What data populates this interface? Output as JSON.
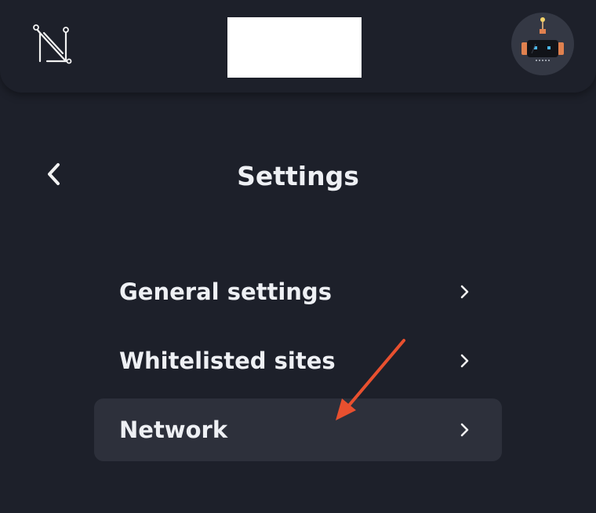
{
  "header": {
    "logo_icon": "network-n-logo-icon",
    "center_box_color": "#ffffff",
    "avatar_icon": "robot-avatar-icon"
  },
  "page": {
    "title": "Settings",
    "back_icon": "chevron-left-icon"
  },
  "menu": {
    "items": [
      {
        "label": "General settings",
        "icon": "chevron-right-icon",
        "active": false
      },
      {
        "label": "Whitelisted sites",
        "icon": "chevron-right-icon",
        "active": false
      },
      {
        "label": "Network",
        "icon": "chevron-right-icon",
        "active": true
      }
    ]
  },
  "annotation": {
    "arrow_color": "#e8502f",
    "arrow_target": "Network"
  },
  "colors": {
    "background": "#1d202a",
    "active_item": "#2d303b",
    "text": "#eef0f4",
    "avatar_bg": "#343844"
  }
}
